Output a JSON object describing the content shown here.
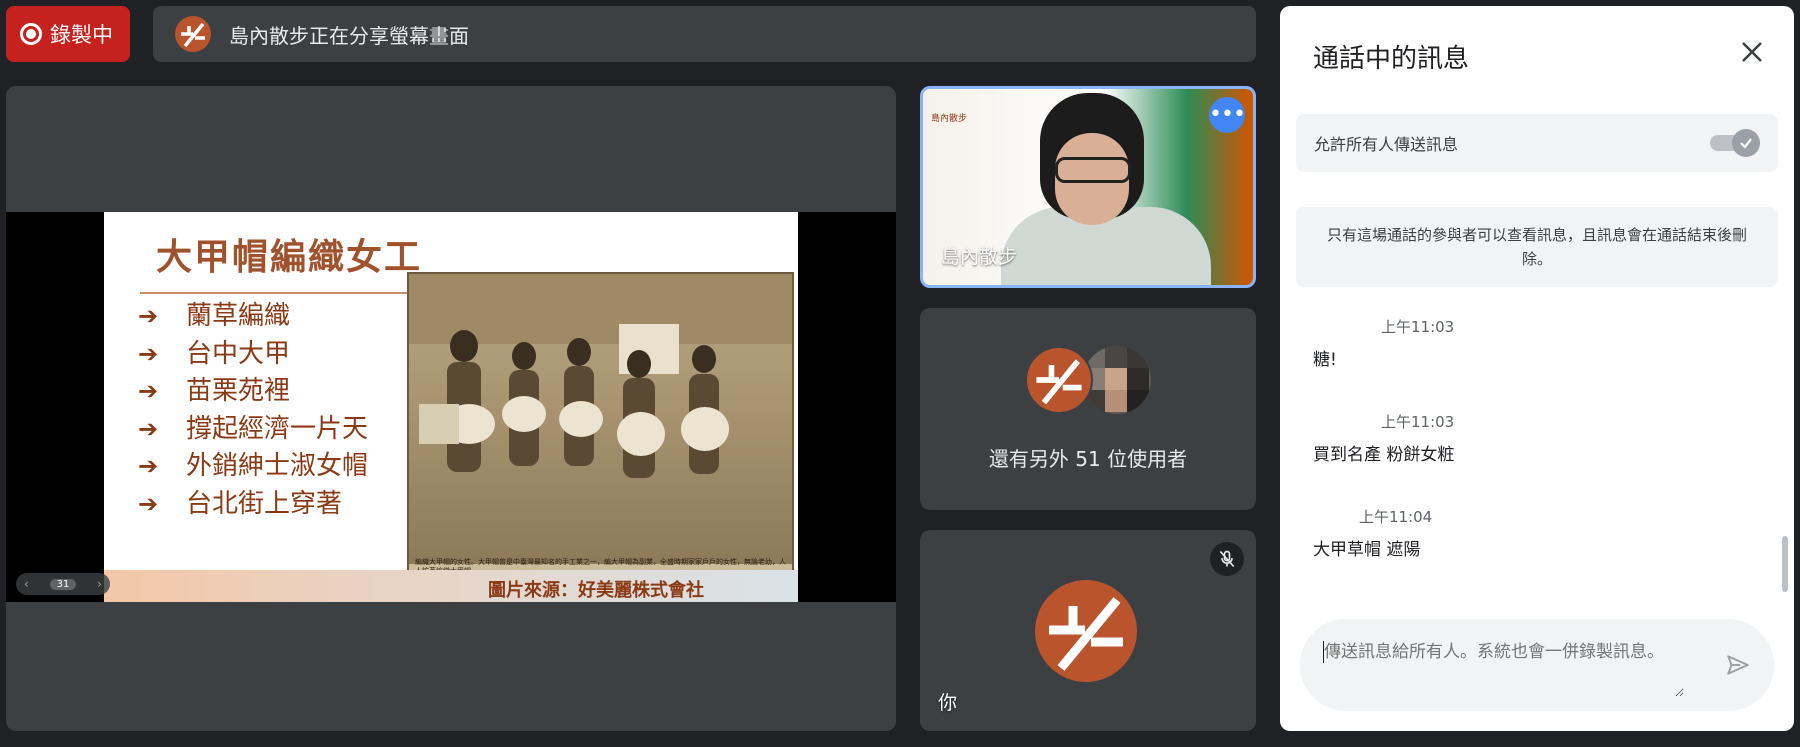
{
  "recording": {
    "label": "錄製中"
  },
  "share_bar": {
    "text": "島內散步正在分享螢幕畫面"
  },
  "slide": {
    "title": "大甲帽編織女工",
    "bullets": [
      "蘭草編織",
      "台中大甲",
      "苗栗苑裡",
      "撐起經濟一片天",
      "外銷紳士淑女帽",
      "台北街上穿著"
    ],
    "photo_caption": "編織大甲帽的女性。大甲帽曾是中臺灣最知名的手工業之一，編大甲帽為副業，全盛時期家家戶戶的女性，無論老幼，人人忙著編織大甲帽。",
    "credit": "圖片來源：好美麗株式會社",
    "page_number": "31"
  },
  "speaker_tile": {
    "name": "島內散步",
    "brand_text": "島內散步"
  },
  "others_tile": {
    "label": "還有另外 51 位使用者"
  },
  "you_tile": {
    "name": "你"
  },
  "chat": {
    "title": "通話中的訊息",
    "allow_label": "允許所有人傳送訊息",
    "notice": "只有這場通話的參與者可以查看訊息，且訊息會在通話結束後刪除。",
    "messages": [
      {
        "time": "上午11:03",
        "text": "糖!"
      },
      {
        "time": "上午11:03",
        "text": "買到名產 粉餅女粧"
      },
      {
        "time": "上午11:04",
        "text": "大甲草帽 遮陽"
      }
    ],
    "input_placeholder": "傳送訊息給所有人。系統也會一併錄製訊息。"
  },
  "colors": {
    "recording_red": "#c5221f",
    "brand_orange": "#b9542d",
    "active_blue": "#8ab4f8",
    "menu_blue": "#4285f4",
    "dark_bg": "#202124",
    "tile_bg": "#3c4043"
  },
  "icons": {
    "record": "record-icon",
    "logo": "logo-icon",
    "more": "more-options-icon",
    "mic_off": "mic-off-icon",
    "close": "close-icon",
    "check": "check-icon",
    "send": "send-icon",
    "arrow": "arrow-right-icon"
  }
}
